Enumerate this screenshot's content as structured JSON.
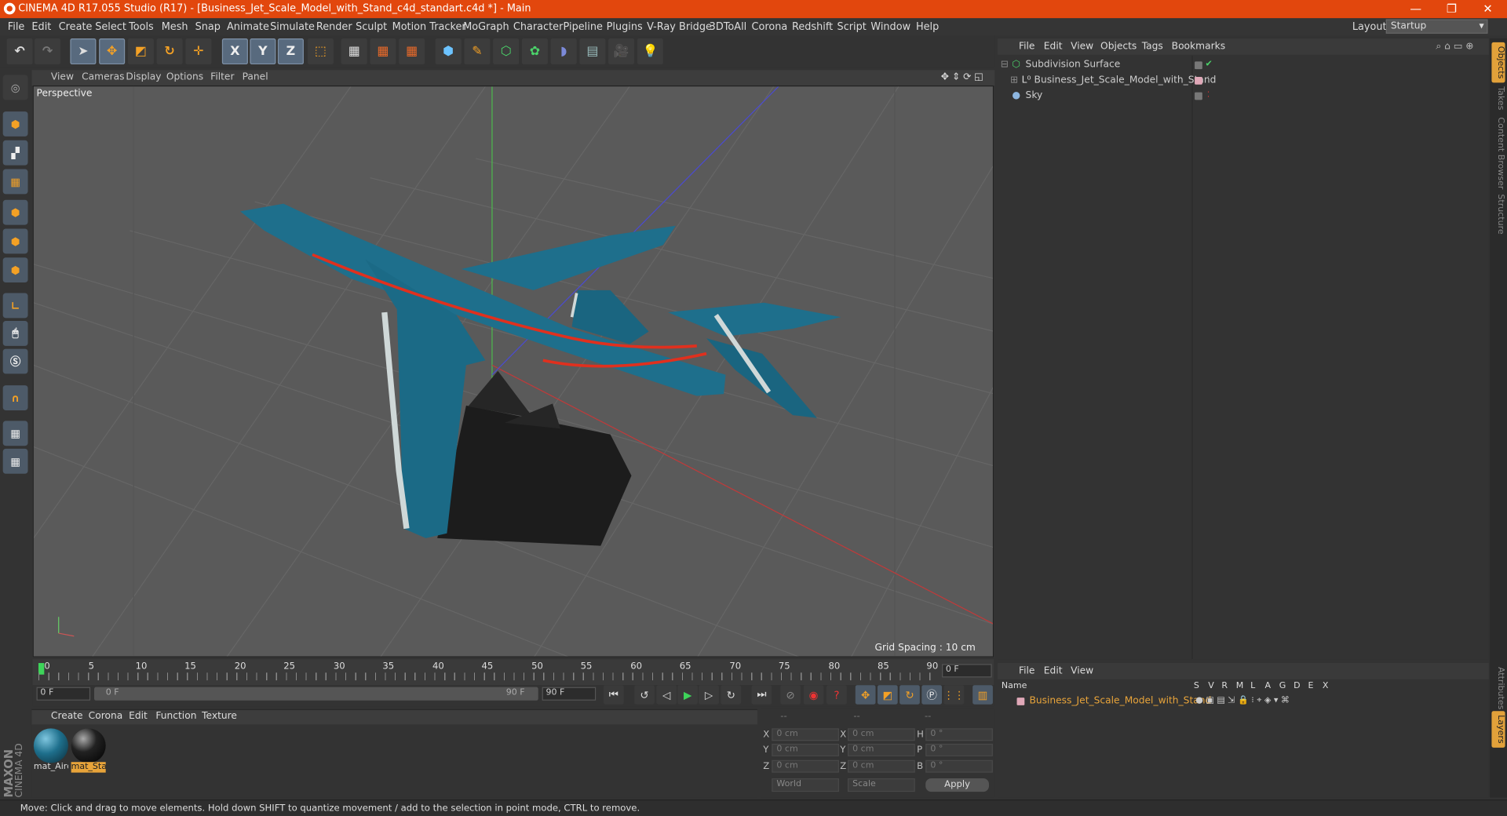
{
  "window": {
    "title": "CINEMA 4D R17.055 Studio (R17) - [Business_Jet_Scale_Model_with_Stand_c4d_standart.c4d *] - Main"
  },
  "menu": [
    "File",
    "Edit",
    "Create",
    "Select",
    "Tools",
    "Mesh",
    "Snap",
    "Animate",
    "Simulate",
    "Render",
    "Sculpt",
    "Motion Tracker",
    "MoGraph",
    "Character",
    "Pipeline",
    "Plugins",
    "V-Ray Bridge",
    "3DToAll",
    "Corona",
    "Redshift",
    "Script",
    "Window",
    "Help"
  ],
  "layout": {
    "label": "Layout:",
    "value": "Startup"
  },
  "toolbar": {
    "x": "X",
    "y": "Y",
    "z": "Z"
  },
  "viewport": {
    "menu": [
      "View",
      "Cameras",
      "Display",
      "Options",
      "Filter",
      "Panel"
    ],
    "camera": "Perspective",
    "grid_spacing": "Grid Spacing : 10 cm"
  },
  "timeline": {
    "ticks": [
      "0",
      "5",
      "10",
      "15",
      "20",
      "25",
      "30",
      "35",
      "40",
      "45",
      "50",
      "55",
      "60",
      "65",
      "70",
      "75",
      "80",
      "85",
      "90"
    ],
    "current_frame": "0 F",
    "start": "0 F",
    "range_start": "0 F",
    "range_end": "90 F",
    "end": "90 F"
  },
  "materials": {
    "menu": [
      "Create",
      "Corona",
      "Edit",
      "Function",
      "Texture"
    ],
    "items": [
      "mat_Airc",
      "mat_Sta"
    ]
  },
  "coords": {
    "headers": [
      "--",
      "--",
      "--"
    ],
    "rows": [
      {
        "a": "X",
        "av": "0 cm",
        "b": "X",
        "bv": "0 cm",
        "c": "H",
        "cv": "0 °"
      },
      {
        "a": "Y",
        "av": "0 cm",
        "b": "Y",
        "bv": "0 cm",
        "c": "P",
        "cv": "0 °"
      },
      {
        "a": "Z",
        "av": "0 cm",
        "b": "Z",
        "bv": "0 cm",
        "c": "B",
        "cv": "0 °"
      }
    ],
    "world": "World",
    "scale": "Scale",
    "apply": "Apply"
  },
  "objects": {
    "menu": [
      "File",
      "Edit",
      "View",
      "Objects",
      "Tags",
      "Bookmarks"
    ],
    "items": [
      "Subdivision Surface",
      "Business_Jet_Scale_Model_with_Stand",
      "Sky"
    ]
  },
  "layers": {
    "menu": [
      "File",
      "Edit",
      "View"
    ],
    "columns": [
      "Name",
      "S",
      "V",
      "R",
      "M",
      "L",
      "A",
      "G",
      "D",
      "E",
      "X"
    ],
    "items": [
      "Business_Jet_Scale_Model_with_Stand"
    ]
  },
  "right_tabs": [
    "Objects",
    "Takes",
    "Content Browser",
    "Structure",
    "Attributes",
    "Layers"
  ],
  "brand": {
    "maxon": "MAXON",
    "c4d": "CINEMA 4D"
  },
  "status": "Move: Click and drag to move elements. Hold down SHIFT to quantize movement / add to the selection in point mode, CTRL to remove.",
  "colors": {
    "accent": "#e2470d",
    "jet": "#1e6f8c",
    "stripe": "#e0301e",
    "layer_name": "#e8a43a"
  }
}
